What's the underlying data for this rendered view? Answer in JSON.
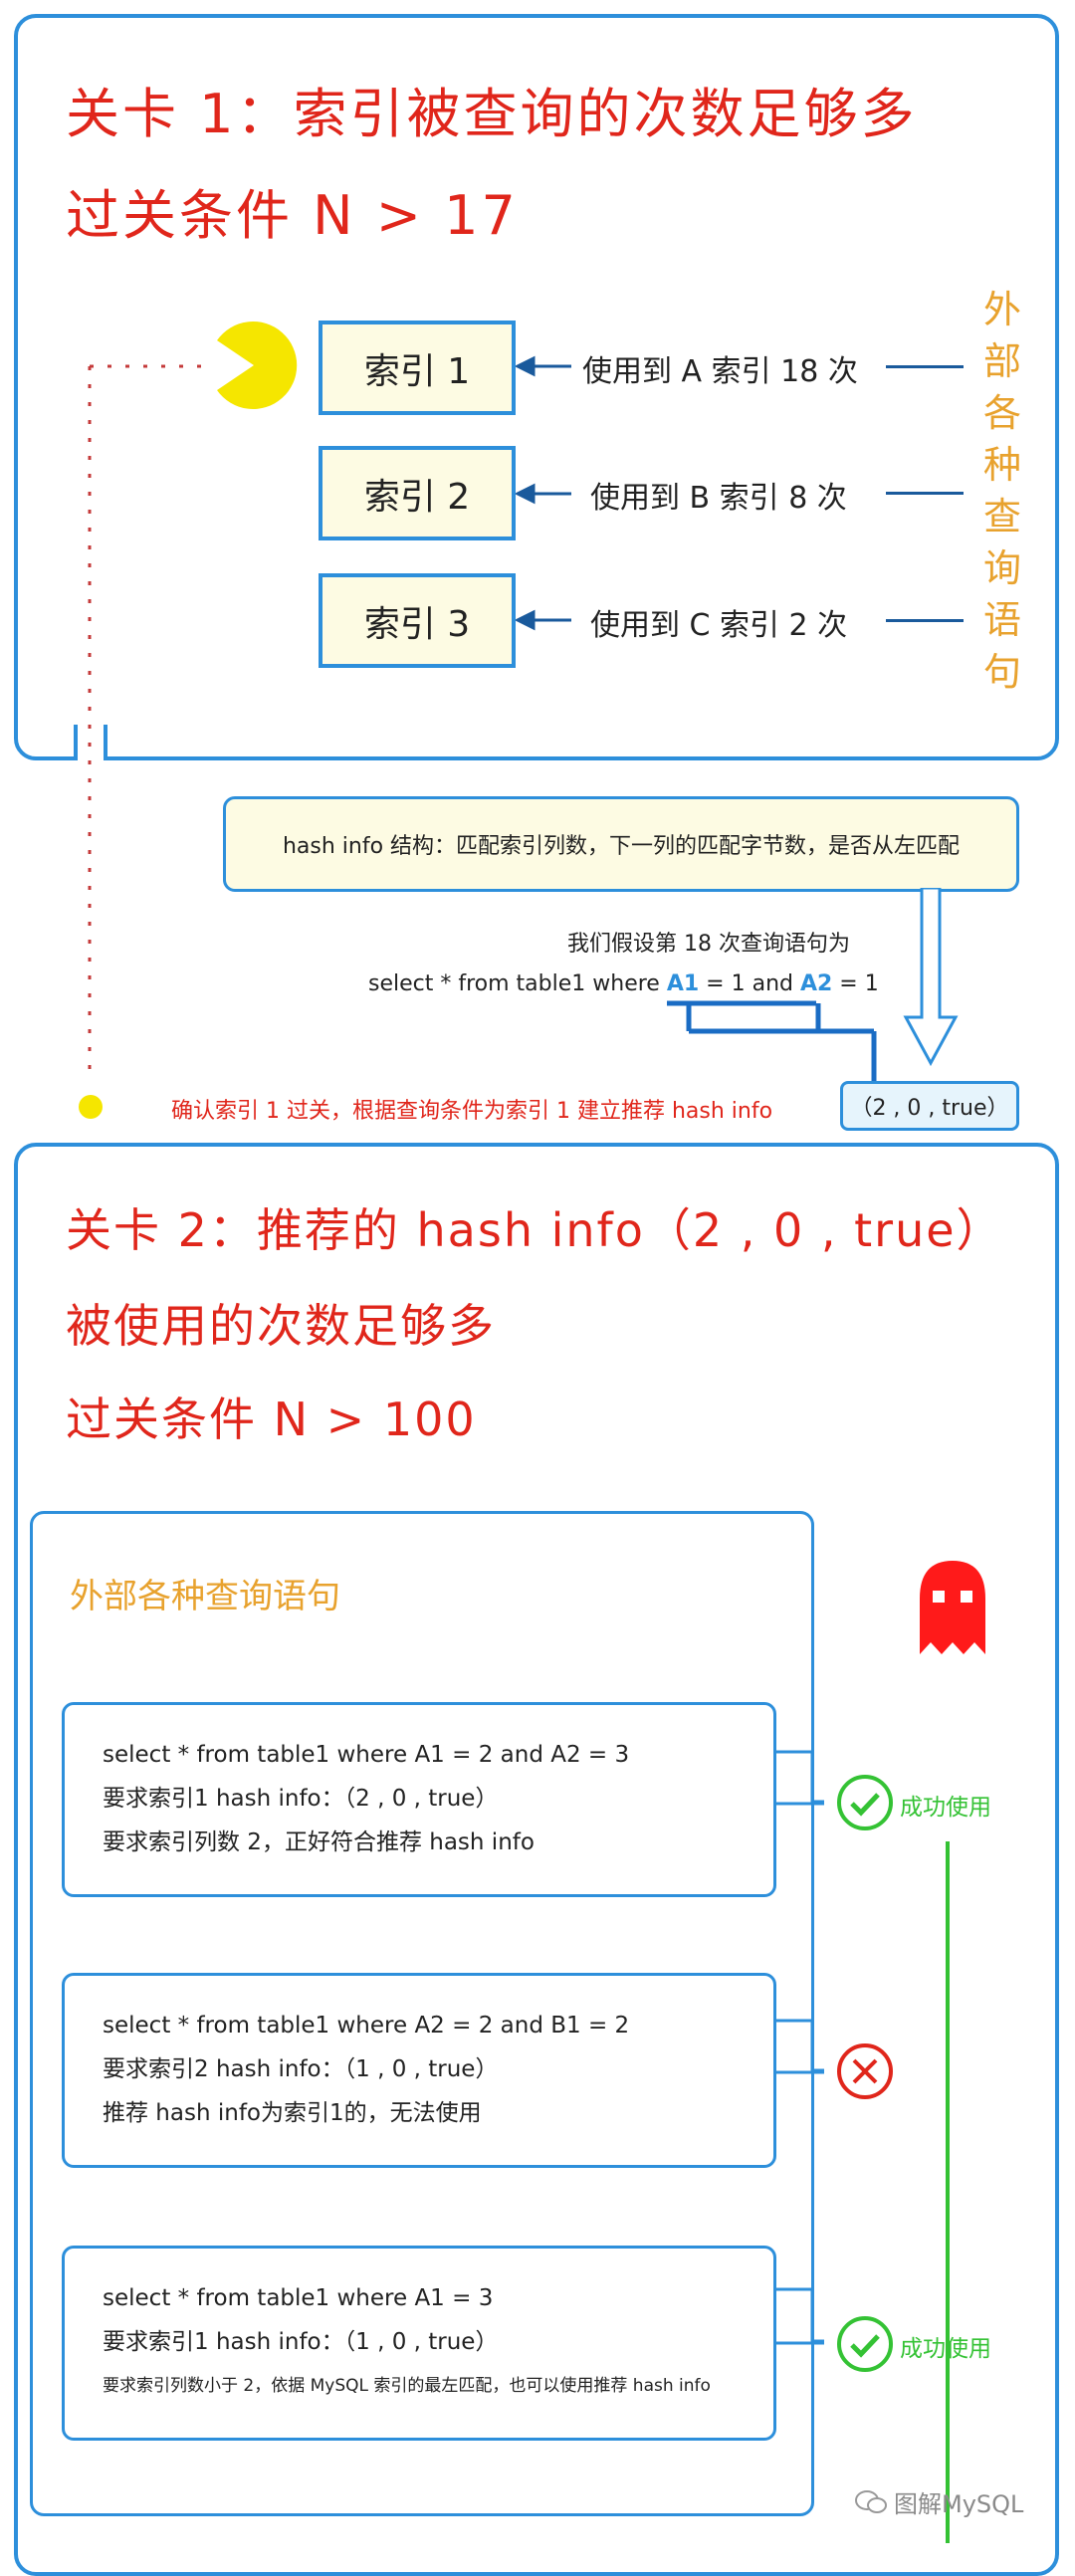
{
  "level1": {
    "title": "关卡 1：索引被查询的次数足够多",
    "condition": "过关条件 N > 17",
    "indexes": [
      {
        "label": "索引 1",
        "usage": "使用到 A 索引 18 次"
      },
      {
        "label": "索引 2",
        "usage": "使用到 B 索引 8 次"
      },
      {
        "label": "索引 3",
        "usage": "使用到 C 索引 2 次"
      }
    ],
    "side_label": [
      "外",
      "部",
      "各",
      "种",
      "查",
      "询",
      "语",
      "句"
    ]
  },
  "hash_info": {
    "structure": "hash info 结构：匹配索引列数，下一列的匹配字节数，是否从左匹配",
    "assume": "我们假设第 18 次查询语句为",
    "sql_prefix": "select * from table1 where ",
    "col_a": "A1",
    "mid": " = 1 and ",
    "col_b": "A2",
    "suffix": " = 1",
    "confirm": "确认索引 1 过关，根据查询条件为索引 1 建立推荐 hash info",
    "result": "（2 , 0 , true）"
  },
  "level2": {
    "title_line1": "关卡 2：推荐的 hash info（2 , 0 , true）",
    "title_line2": "被使用的次数足够多",
    "condition": "过关条件 N > 100",
    "queries_heading": "外部各种查询语句",
    "queries": [
      {
        "lines": [
          "select * from table1 where A1 = 2 and A2 = 3",
          "要求索引1 hash info：（2 , 0 , true）",
          "要求索引列数 2，正好符合推荐 hash info"
        ],
        "result": "成功使用"
      },
      {
        "lines": [
          "select * from table1 where A2 = 2 and B1 = 2",
          "要求索引2 hash info：（1 , 0 , true）",
          "推荐 hash info为索引1的，无法使用"
        ],
        "result": ""
      },
      {
        "lines": [
          "select * from table1 where A1 = 3",
          "要求索引1 hash info：（1 , 0 , true）",
          "要求索引列数小于 2，依据 MySQL 索引的最左匹配，也可以使用推荐 hash info"
        ],
        "result": "成功使用"
      }
    ]
  },
  "watermark": "图解MySQL",
  "colors": {
    "blue": "#2d8fdb",
    "red": "#e0261b",
    "orange": "#e8a22e",
    "green": "#34c234",
    "yellow": "#f5e600"
  }
}
